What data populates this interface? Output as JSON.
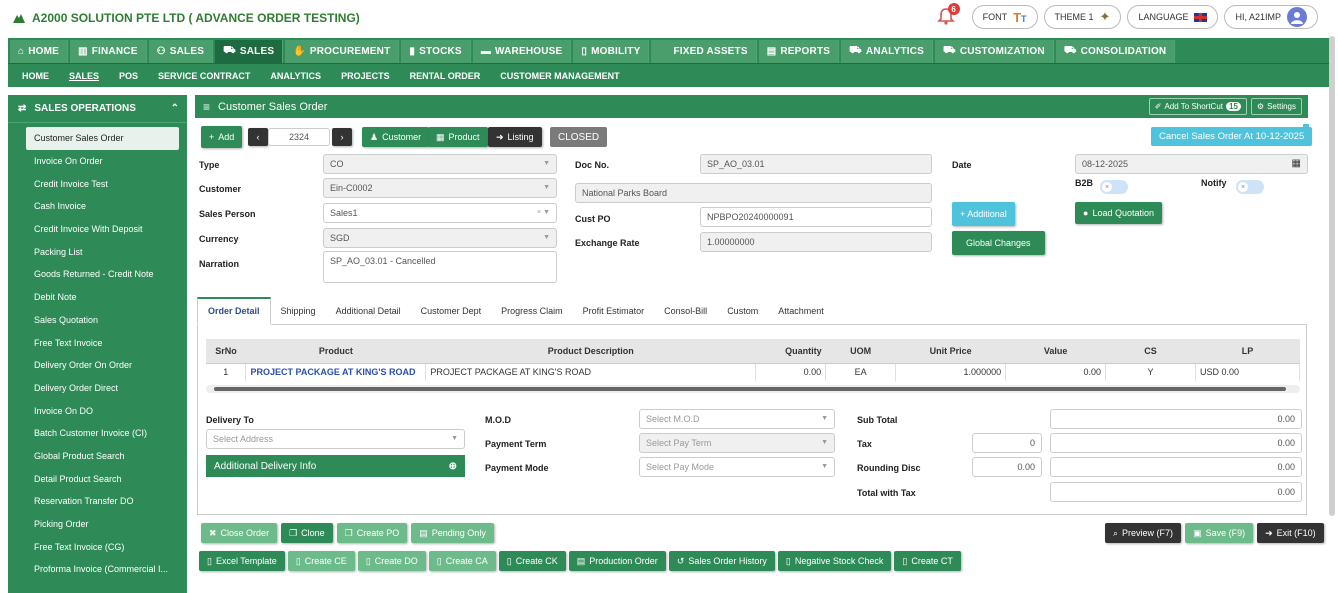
{
  "app": {
    "title": "A2000 SOLUTION PTE LTD ( ADVANCE ORDER TESTING)",
    "notif_count": "6",
    "font_label": "FONT",
    "theme_label": "THEME 1",
    "language_label": "LANGUAGE",
    "user_label": "HI, A21IMP"
  },
  "mainnav": [
    {
      "label": "HOME"
    },
    {
      "label": "FINANCE"
    },
    {
      "label": "SALES"
    },
    {
      "label": "SALES"
    },
    {
      "label": "PROCUREMENT"
    },
    {
      "label": "STOCKS"
    },
    {
      "label": "WAREHOUSE"
    },
    {
      "label": "MOBILITY"
    },
    {
      "label": "FIXED ASSETS"
    },
    {
      "label": "REPORTS"
    },
    {
      "label": "ANALYTICS"
    },
    {
      "label": "CUSTOMIZATION"
    },
    {
      "label": "CONSOLIDATION"
    }
  ],
  "subnav": [
    "HOME",
    "SALES",
    "POS",
    "SERVICE CONTRACT",
    "ANALYTICS",
    "PROJECTS",
    "RENTAL ORDER",
    "CUSTOMER MANAGEMENT"
  ],
  "sidebar": {
    "title": "SALES OPERATIONS",
    "items": [
      "Customer Sales Order",
      "Invoice On Order",
      "Credit Invoice Test",
      "Cash Invoice",
      "Credit Invoice With Deposit",
      "Packing List",
      "Goods Returned - Credit Note",
      "Debit Note",
      "Sales Quotation",
      "Free Text Invoice",
      "Delivery Order On Order",
      "Delivery Order Direct",
      "Invoice On DO",
      "Batch Customer Invoice (CI)",
      "Global Product Search",
      "Detail Product Search",
      "Reservation Transfer DO",
      "Picking Order",
      "Free Text Invoice (CG)",
      "Proforma Invoice (Commercial I..."
    ]
  },
  "panel": {
    "title": "Customer Sales Order",
    "shortcut_label": "Add To ShortCut",
    "shortcut_count": "15",
    "settings_label": "Settings",
    "add_label": "Add",
    "record_no": "2324",
    "customer_btn": "Customer",
    "product_btn": "Product",
    "listing_btn": "Listing",
    "status": "CLOSED",
    "cancel_note": "Cancel Sales Order At 10-12-2025"
  },
  "form": {
    "type_label": "Type",
    "type_value": "CO",
    "customer_label": "Customer",
    "customer_value": "Ein-C0002",
    "salesperson_label": "Sales Person",
    "salesperson_value": "Sales1",
    "currency_label": "Currency",
    "currency_value": "SGD",
    "narration_label": "Narration",
    "narration_value": "SP_AO_03.01 - Cancelled",
    "docno_label": "Doc No.",
    "docno_value": "SP_AO_03.01",
    "customer_name": "National Parks Board",
    "custpo_label": "Cust PO",
    "custpo_value": "NPBPO20240000091",
    "exrate_label": "Exchange Rate",
    "exrate_value": "1.00000000",
    "date_label": "Date",
    "date_value": "08-12-2025",
    "b2b_label": "B2B",
    "notify_label": "Notify",
    "additional_btn": "+ Additional",
    "global_btn": "Global Changes",
    "load_quotation_btn": "Load Quotation"
  },
  "tabs": [
    "Order Detail",
    "Shipping",
    "Additional Detail",
    "Customer Dept",
    "Progress Claim",
    "Profit Estimator",
    "Consol-Bill",
    "Custom",
    "Attachment"
  ],
  "grid": {
    "headers": [
      "SrNo",
      "Product",
      "Product Description",
      "Quantity",
      "UOM",
      "Unit Price",
      "Value",
      "CS",
      "LP"
    ],
    "rows": [
      {
        "srno": "1",
        "product": "PROJECT PACKAGE AT KING'S ROAD",
        "desc": "PROJECT PACKAGE AT KING'S ROAD",
        "qty": "0.00",
        "uom": "EA",
        "price": "1.000000",
        "value": "0.00",
        "cs": "Y",
        "lp": "USD 0.00"
      }
    ]
  },
  "delivery": {
    "delivery_to_label": "Delivery To",
    "address_placeholder": "Select Address",
    "additional_info": "Additional Delivery Info",
    "mod_label": "M.O.D",
    "mod_placeholder": "Select M.O.D",
    "payterm_label": "Payment Term",
    "payterm_placeholder": "Select Pay Term",
    "paymode_label": "Payment Mode",
    "paymode_placeholder": "Select Pay Mode",
    "subtotal_label": "Sub Total",
    "subtotal_value": "0.00",
    "tax_label": "Tax",
    "tax_rate": "0",
    "tax_value": "0.00",
    "rounding_label": "Rounding Disc",
    "rounding_rate": "0.00",
    "rounding_value": "0.00",
    "total_label": "Total with Tax",
    "total_value": "0.00"
  },
  "actions": {
    "close_order": "Close Order",
    "clone": "Clone",
    "create_po": "Create PO",
    "pending_only": "Pending Only",
    "preview": "Preview (F7)",
    "save": "Save (F9)",
    "exit": "Exit (F10)",
    "excel_template": "Excel Template",
    "create_ce": "Create CE",
    "create_do": "Create DO",
    "create_ca": "Create CA",
    "create_ck": "Create CK",
    "production_order": "Production Order",
    "history": "Sales Order History",
    "negative_stock": "Negative Stock Check",
    "create_ct": "Create CT"
  }
}
